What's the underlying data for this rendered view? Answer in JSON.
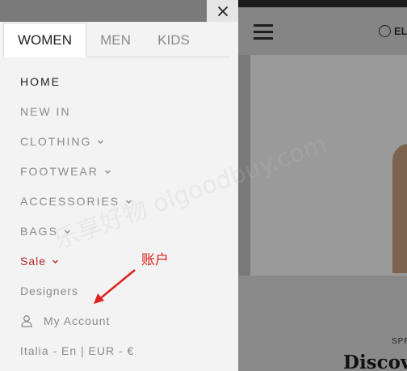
{
  "drawer": {
    "close_icon": "close-icon",
    "tabs": [
      {
        "label": "WOMEN",
        "active": true
      },
      {
        "label": "MEN",
        "active": false
      },
      {
        "label": "KIDS",
        "active": false
      }
    ],
    "menu": {
      "home": "HOME",
      "new_in": "NEW IN",
      "clothing": "CLOTHING",
      "footwear": "FOOTWEAR",
      "accessories": "ACCESSORIES",
      "bags": "BAGS",
      "sale": "Sale",
      "designers": "Designers",
      "my_account": "My Account",
      "locale": "Italia - En | EUR - €"
    },
    "sale_color": "#b1282b"
  },
  "site": {
    "header": {
      "menu_icon": "hamburger-icon",
      "lang_label": "EL"
    },
    "hero": {
      "kicker": "SPR",
      "title": "Discov"
    }
  },
  "annotation": {
    "label": "账户",
    "color": "#e0201c"
  },
  "watermark": {
    "text": "乐享好物 olgoodbuy.com"
  }
}
